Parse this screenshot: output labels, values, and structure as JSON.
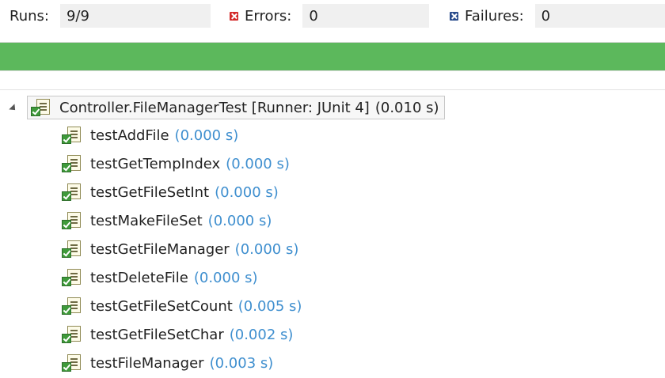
{
  "stats": {
    "runs_label": "Runs:",
    "runs_value": "9/9",
    "errors_label": "Errors:",
    "errors_value": "0",
    "failures_label": "Failures:",
    "failures_value": "0"
  },
  "progress": {
    "fraction": 1.0,
    "color": "#5cb85c"
  },
  "tree": {
    "root": {
      "label": "Controller.FileManagerTest [Runner: JUnit 4]",
      "time": "(0.010 s)",
      "icon": "test-suite-passed-icon"
    },
    "tests": [
      {
        "name": "testAddFile",
        "time": "(0.000 s)"
      },
      {
        "name": "testGetTempIndex",
        "time": "(0.000 s)"
      },
      {
        "name": "testGetFileSetInt",
        "time": "(0.000 s)"
      },
      {
        "name": "testMakeFileSet",
        "time": "(0.000 s)"
      },
      {
        "name": "testGetFileManager",
        "time": "(0.000 s)"
      },
      {
        "name": "testDeleteFile",
        "time": "(0.000 s)"
      },
      {
        "name": "testGetFileSetCount",
        "time": "(0.005 s)"
      },
      {
        "name": "testGetFileSetChar",
        "time": "(0.002 s)"
      },
      {
        "name": "testFileManager",
        "time": "(0.003 s)"
      }
    ]
  },
  "colors": {
    "time_text": "#3f8fcf",
    "error_icon": "#d32a2a",
    "failure_icon": "#2a4c8c"
  }
}
